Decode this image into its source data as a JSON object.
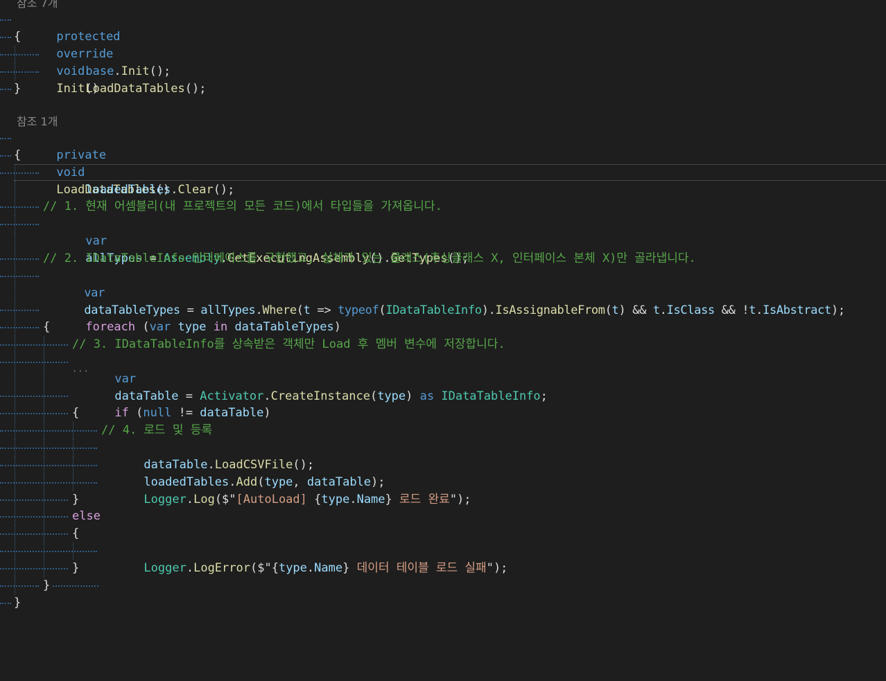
{
  "codelens": {
    "init_refs": "참조 7개",
    "load_refs": "참조 1개"
  },
  "code": {
    "l1_kw1": "protected",
    "l1_kw2": "override",
    "l1_kw3": "void",
    "l1_fn": "Init",
    "l1_tail": "()",
    "open_brace": "{",
    "close_brace": "}",
    "l3_base": "base",
    "l3_dot": ".",
    "l3_fn": "Init",
    "l3_tail": "();",
    "l4_fn": "LoadDataTables",
    "l4_tail": "();",
    "l6_kw1": "private",
    "l6_kw2": "void",
    "l6_fn": "LoadDataTables",
    "l6_tail": "()",
    "l8_var": "loadedTables",
    "l8_dot": ".",
    "l8_fn": "Clear",
    "l8_tail": "();",
    "c1": "// 1. 현재 어셈블리(내 프로젝트의 모든 코드)에서 타입들을 가져옵니다.",
    "l10_kw": "var",
    "l10_var": "allTypes",
    "l10_eq": " = ",
    "l10_ty": "Assembly",
    "l10_dot1": ".",
    "l10_fn1": "GetExecutingAssembly",
    "l10_mid": "().",
    "l10_fn2": "GetTypes",
    "l10_tail": "();",
    "c2": "// 2. IDataTableInfo 인터페이스를 구현했고, 실체가 있는 클래스(추상클래스 X, 인터페이스 본체 X)만 골라냅니다.",
    "l12_kw": "var",
    "l12_var": "dataTableTypes",
    "l12_eq": " = ",
    "l12_var2": "allTypes",
    "l12_dot": ".",
    "l12_fn": "Where",
    "l12_p1": "(",
    "l12_t1": "t",
    "l12_arrow": " => ",
    "l12_typeof": "typeof",
    "l12_p2": "(",
    "l12_ty": "IDataTableInfo",
    "l12_p3": ").",
    "l12_fn2": "IsAssignableFrom",
    "l12_p4": "(",
    "l12_t2": "t",
    "l12_p5": ") && ",
    "l12_t3": "t",
    "l12_dot2": ".",
    "l12_prop1": "IsClass",
    "l12_and": " && !",
    "l12_t4": "t",
    "l12_dot3": ".",
    "l12_prop2": "IsAbstract",
    "l12_tail": ");",
    "l14_kw": "foreach",
    "l14_p1": " (",
    "l14_var": "var",
    "l14_sp": " ",
    "l14_type": "type",
    "l14_in": " in ",
    "l14_coll": "dataTableTypes",
    "l14_tail": ")",
    "c3": "// 3. IDataTableInfo를 상속받은 객체만 Load 후 멤버 변수에 저장합니다.",
    "l17_kw": "var",
    "l17_var": "dataTable",
    "l17_eq": " = ",
    "l17_ty": "Activator",
    "l17_dot": ".",
    "l17_fn": "CreateInstance",
    "l17_p1": "(",
    "l17_arg": "type",
    "l17_p2": ") ",
    "l17_as": "as",
    "l17_sp": " ",
    "l17_ty2": "IDataTableInfo",
    "l17_tail": ";",
    "l19_if": "if",
    "l19_p1": " (",
    "l19_null": "null",
    "l19_ne": " != ",
    "l19_var": "dataTable",
    "l19_tail": ")",
    "c4": "// 4. 로드 및 등록",
    "l22_var": "dataTable",
    "l22_dot": ".",
    "l22_fn": "LoadCSVFile",
    "l22_tail": "();",
    "l23_var": "loadedTables",
    "l23_dot": ".",
    "l23_fn": "Add",
    "l23_p1": "(",
    "l23_a1": "type",
    "l23_comma": ", ",
    "l23_a2": "dataTable",
    "l23_tail": ");",
    "l24_ty": "Logger",
    "l24_dot": ".",
    "l24_fn": "Log",
    "l24_p1": "($\"",
    "l24_s1": "[AutoLoad] ",
    "l24_b1": "{",
    "l24_v1": "type",
    "l24_dot2": ".",
    "l24_v2": "Name",
    "l24_b2": "}",
    "l24_s2": " 로드 완료",
    "l24_tail": "\");",
    "l26_else": "else",
    "l28_ty": "Logger",
    "l28_dot": ".",
    "l28_fn": "LogError",
    "l28_p1": "($\"",
    "l28_b1": "{",
    "l28_v1": "type",
    "l28_dot2": ".",
    "l28_v2": "Name",
    "l28_b2": "}",
    "l28_s1": " 데이터 테이블 로드 실패",
    "l28_tail": "\");",
    "squiggle": "···"
  },
  "colors": {
    "background": "#1e1e1e",
    "keyword": "#569cd6",
    "control_keyword": "#d8a0df",
    "type": "#4ec9b0",
    "method": "#dcdcaa",
    "variable": "#9cdcfe",
    "comment": "#57a64a",
    "string": "#d69d85",
    "text": "#dcdcdc"
  }
}
